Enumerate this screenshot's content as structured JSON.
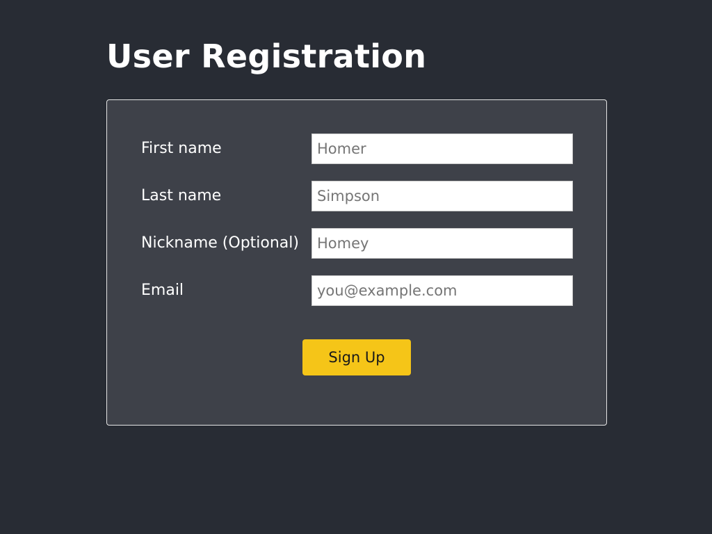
{
  "page": {
    "title": "User Registration"
  },
  "form": {
    "fields": [
      {
        "label": "First name",
        "placeholder": "Homer",
        "value": ""
      },
      {
        "label": "Last name",
        "placeholder": "Simpson",
        "value": ""
      },
      {
        "label": "Nickname (Optional)",
        "placeholder": "Homey",
        "value": ""
      },
      {
        "label": "Email",
        "placeholder": "you@example.com",
        "value": ""
      }
    ],
    "submit_label": "Sign Up"
  },
  "colors": {
    "background": "#282c34",
    "card": "#3e4149",
    "accent": "#f5c518"
  }
}
